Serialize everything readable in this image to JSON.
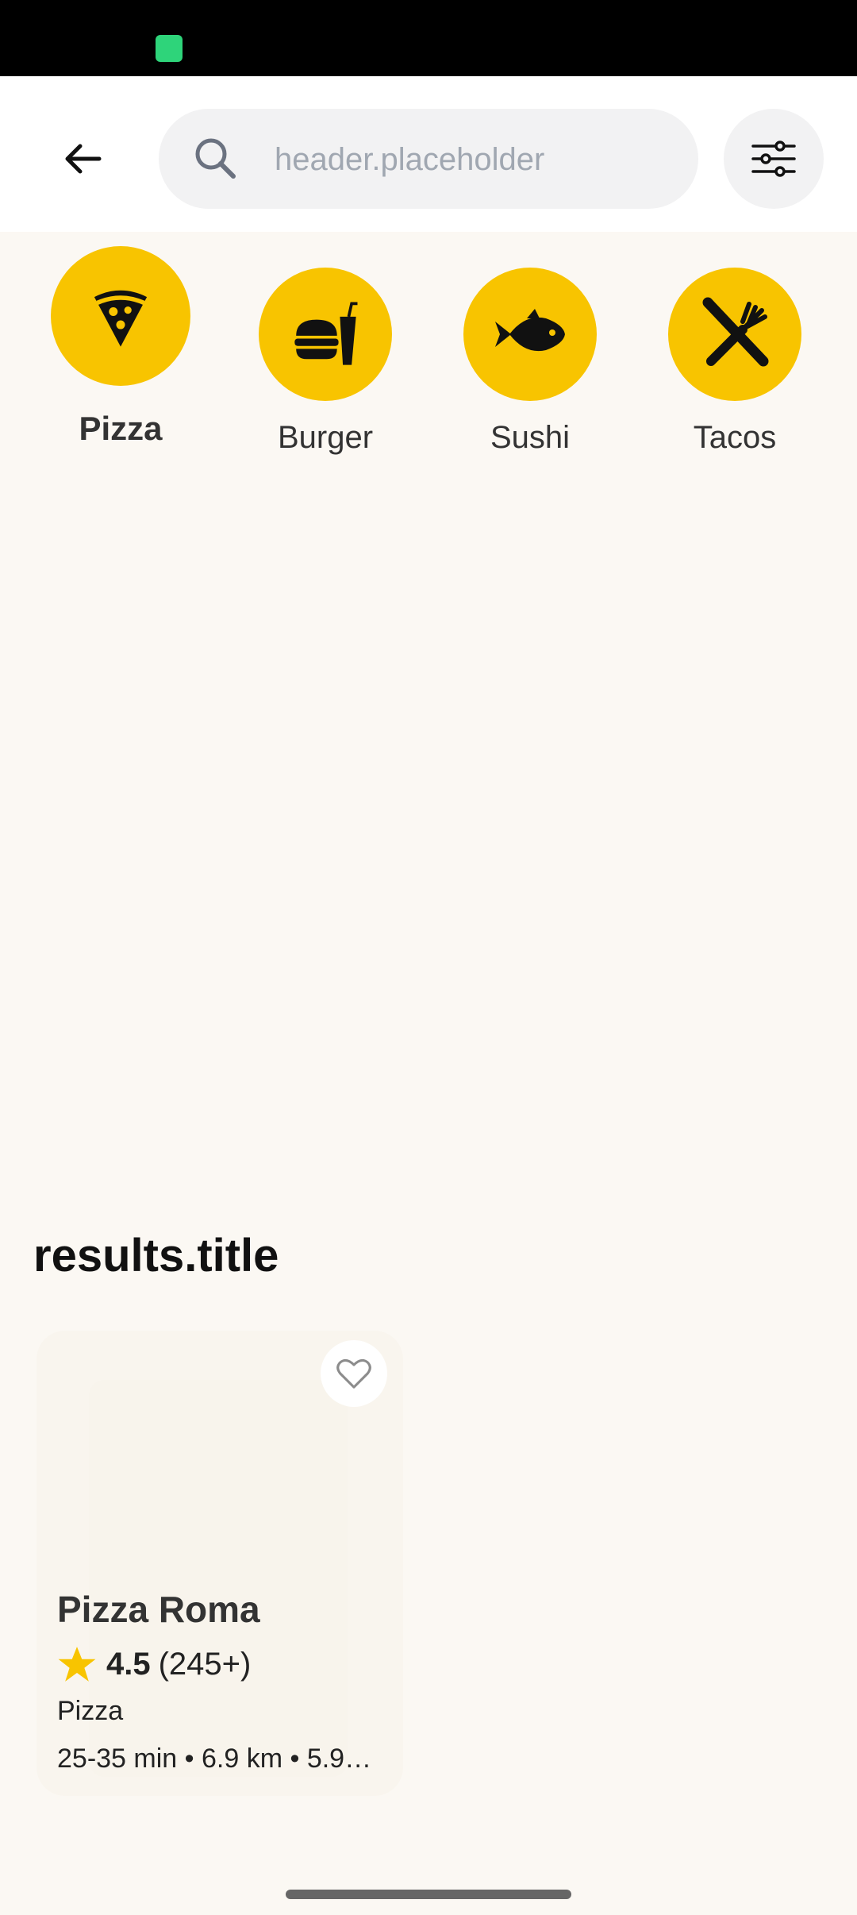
{
  "colors": {
    "accent": "#F8C400",
    "background": "#FBF8F3",
    "header_background": "#FFFFFF",
    "search_background": "#F2F2F3"
  },
  "header": {
    "placeholder": "header.placeholder",
    "back_icon": "arrow-left-icon",
    "search_icon": "magnifier-icon",
    "filter_icon": "sliders-icon"
  },
  "categories": [
    {
      "label": "Pizza",
      "icon": "pizza-slice-icon",
      "active": true
    },
    {
      "label": "Burger",
      "icon": "burger-drink-icon",
      "active": false
    },
    {
      "label": "Sushi",
      "icon": "fish-icon",
      "active": false
    },
    {
      "label": "Tacos",
      "icon": "utensils-icon",
      "active": false
    }
  ],
  "results": {
    "title": "results.title",
    "cards": [
      {
        "name": "Pizza Roma",
        "rating": "4.5",
        "rating_count": "(245+)",
        "category": "Pizza",
        "meta": "25-35 min • 6.9 km • 5.9…",
        "favorite_icon": "heart-outline-icon"
      }
    ]
  }
}
